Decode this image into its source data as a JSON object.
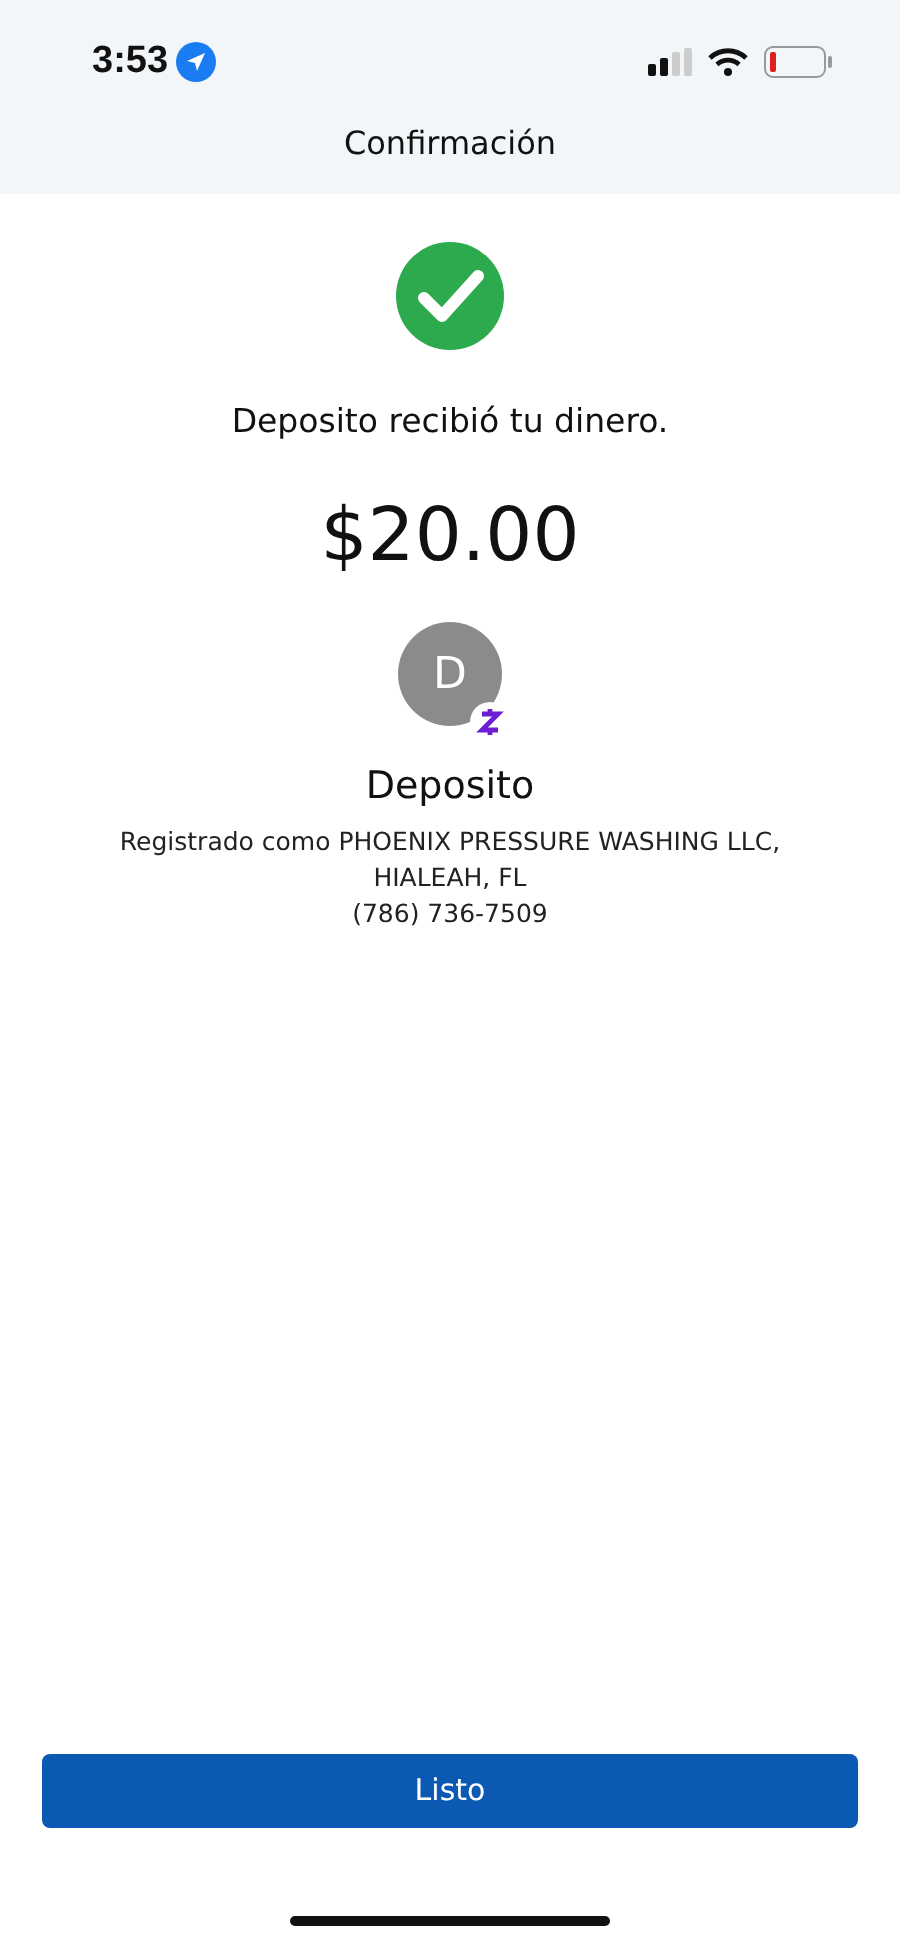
{
  "status_bar": {
    "time": "3:53"
  },
  "header": {
    "title": "Confirmación"
  },
  "confirmation": {
    "message": "Deposito recibió tu dinero.",
    "amount": "$20.00"
  },
  "recipient": {
    "initial": "D",
    "name": "Deposito",
    "details": [
      "Registrado como PHOENIX PRESSURE WASHING LLC,",
      "HIALEAH, FL",
      "(786) 736-7509"
    ]
  },
  "buttons": [
    {
      "label": "Listo"
    }
  ]
}
